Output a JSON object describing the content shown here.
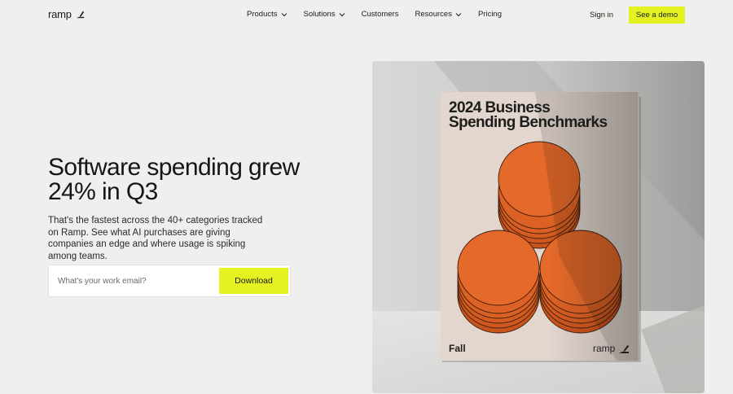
{
  "brand": {
    "name": "ramp"
  },
  "nav": {
    "items": [
      {
        "label": "Products",
        "dropdown": true
      },
      {
        "label": "Solutions",
        "dropdown": true
      },
      {
        "label": "Customers",
        "dropdown": false
      },
      {
        "label": "Resources",
        "dropdown": true
      },
      {
        "label": "Pricing",
        "dropdown": false
      }
    ],
    "sign_in": "Sign in",
    "demo": "See a demo"
  },
  "hero": {
    "headline_line1": "Software spending grew",
    "headline_line2": "24% in Q3",
    "subtext": "That's the fastest across the 40+ categories tracked on Ramp. See what AI purchases are giving companies an edge and where usage is spiking among teams.",
    "email_placeholder": "What's your work email?",
    "download": "Download"
  },
  "report": {
    "title_line1": "2024 Business",
    "title_line2": "Spending Benchmarks",
    "season": "Fall",
    "brand": "ramp"
  },
  "colors": {
    "accent": "#e4f222",
    "page_bg": "#efefed",
    "cover_bg": "#e2d6cf",
    "coin": "#e4692a"
  }
}
